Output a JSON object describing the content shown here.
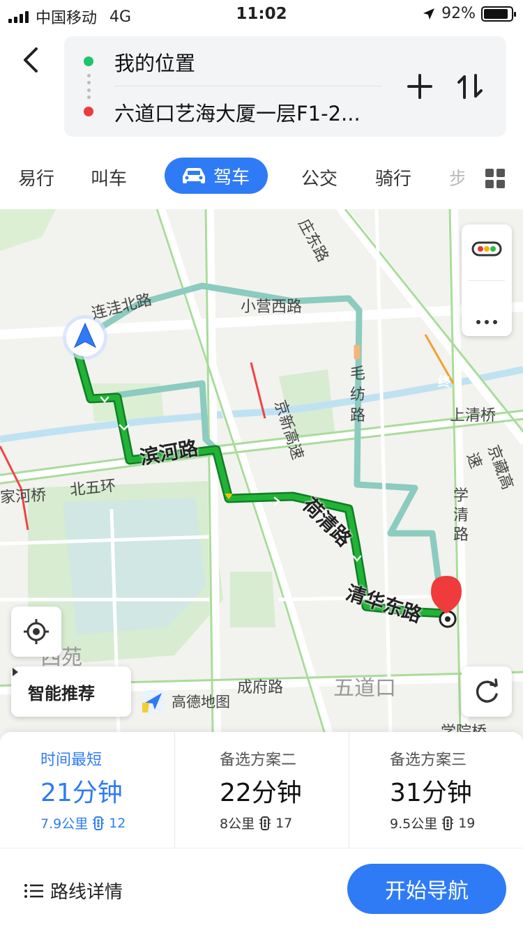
{
  "status_bar": {
    "carrier": "中国移动",
    "network": "4G",
    "time": "11:02",
    "battery": "92%"
  },
  "search": {
    "origin": "我的位置",
    "destination": "六道口艺海大厦一层F1-2..."
  },
  "tabs": [
    {
      "label": "易行"
    },
    {
      "label": "叫车"
    },
    {
      "label": "驾车",
      "active": true
    },
    {
      "label": "公交"
    },
    {
      "label": "骑行"
    },
    {
      "label": "步"
    }
  ],
  "map": {
    "roads": {
      "binhe": "滨河路",
      "heqing": "荷清路",
      "qinghua_east": "清华东路",
      "lianwa_north": "连洼北路",
      "xiaoying_west": "小营西路",
      "maofang": "毛纺路",
      "jingxin": "京新高速",
      "shangqing": "上清桥",
      "jingzang": "京藏高速",
      "xueqing": "学清路",
      "beiwuhuan": "北五环",
      "jiahe": "家河桥",
      "chengfu": "成府路",
      "wudaokou": "五道口",
      "xiyuan": "西苑",
      "zhuang_east": "庄东路",
      "xueyuan_bridge": "学院桥"
    },
    "end_marker": "终",
    "smart_label": "智能推荐",
    "brand": "高德地图",
    "route_color": "#21b336",
    "alt_route_color": "#8ccbbf"
  },
  "routes": [
    {
      "label": "时间最短",
      "time": "21分钟",
      "distance": "7.9公里",
      "lights": "12",
      "active": true
    },
    {
      "label": "备选方案二",
      "time": "22分钟",
      "distance": "8公里",
      "lights": "17"
    },
    {
      "label": "备选方案三",
      "time": "31分钟",
      "distance": "9.5公里",
      "lights": "19"
    }
  ],
  "actions": {
    "details": "路线详情",
    "start": "开始导航"
  }
}
